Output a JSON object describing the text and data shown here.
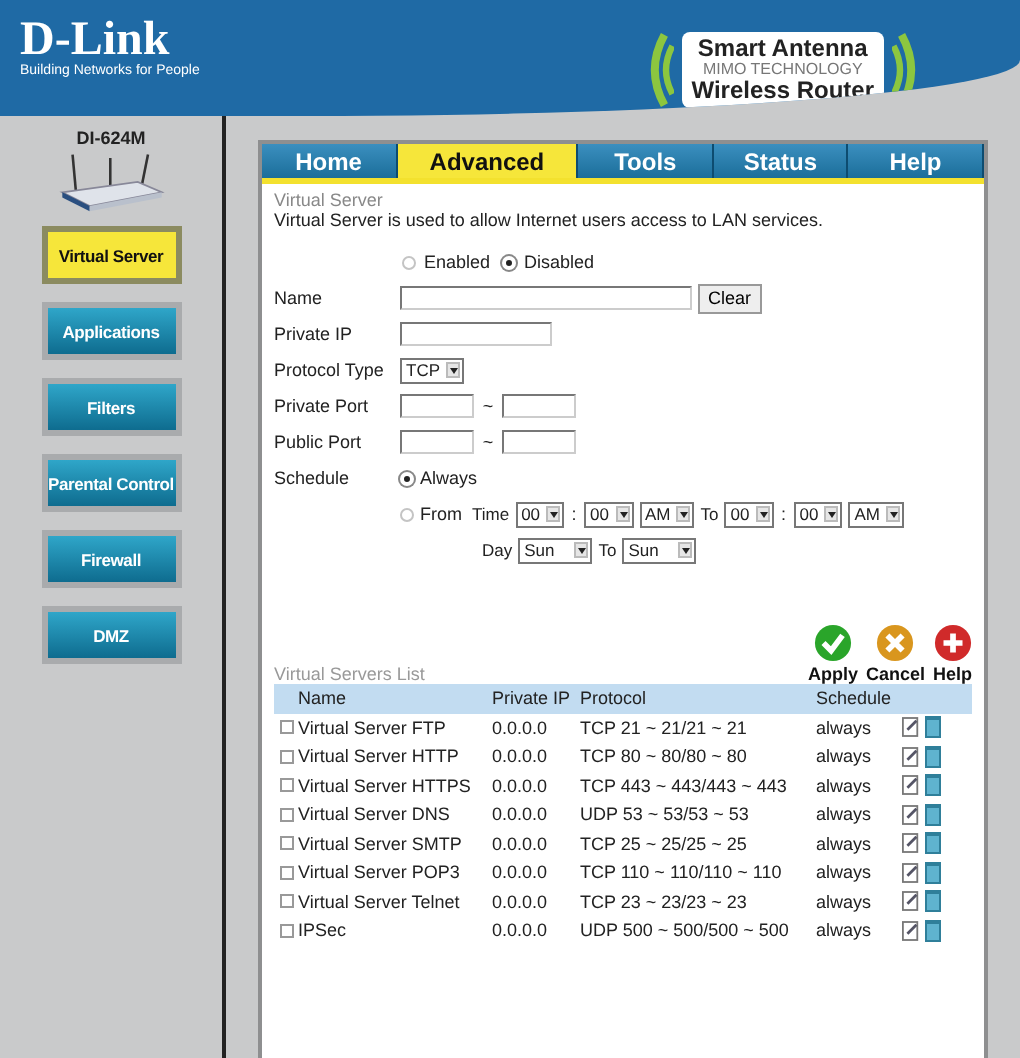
{
  "header": {
    "brand": "D-Link",
    "tagline": "Building Networks for People",
    "badge": [
      "Smart Antenna",
      "MIMO TECHNOLOGY",
      "Wireless Router"
    ]
  },
  "model": "DI-624M",
  "sidebar": {
    "items": [
      {
        "label": "Virtual Server",
        "selected": true
      },
      {
        "label": "Applications",
        "selected": false
      },
      {
        "label": "Filters",
        "selected": false
      },
      {
        "label": "Parental Control",
        "selected": false
      },
      {
        "label": "Firewall",
        "selected": false
      },
      {
        "label": "DMZ",
        "selected": false
      }
    ]
  },
  "tabs": [
    {
      "label": "Home",
      "selected": false
    },
    {
      "label": "Advanced",
      "selected": true
    },
    {
      "label": "Tools",
      "selected": false
    },
    {
      "label": "Status",
      "selected": false
    },
    {
      "label": "Help",
      "selected": false
    }
  ],
  "section": {
    "title": "Virtual Server",
    "description": "Virtual Server is used to allow Internet users access to LAN services."
  },
  "form": {
    "status": [
      {
        "label": "Enabled",
        "selected": false
      },
      {
        "label": "Disabled",
        "selected": true
      }
    ],
    "name_label": "Name",
    "clear_button": "Clear",
    "private_ip_label": "Private IP",
    "protocol_label": "Protocol Type",
    "protocol_value": "TCP",
    "private_port_label": "Private Port",
    "public_port_label": "Public Port",
    "port_separator": "~",
    "schedule_label": "Schedule",
    "schedule_options": [
      {
        "label": "Always",
        "selected": true
      },
      {
        "label": "From",
        "selected": false
      }
    ],
    "time_label": "Time",
    "time_from": [
      "00",
      "00",
      "AM"
    ],
    "time_to_label": "To",
    "time_to": [
      "00",
      "00",
      "AM"
    ],
    "colon": ":",
    "day_label": "Day",
    "day_from": "Sun",
    "day_to_label": "To",
    "day_to": "Sun"
  },
  "actions": [
    {
      "label": "Apply",
      "kind": "apply"
    },
    {
      "label": "Cancel",
      "kind": "cancel"
    },
    {
      "label": "Help",
      "kind": "help"
    }
  ],
  "list": {
    "title": "Virtual Servers List",
    "columns": [
      "Name",
      "Private IP",
      "Protocol",
      "Schedule"
    ],
    "rows": [
      {
        "checked": false,
        "name": "Virtual Server FTP",
        "ip": "0.0.0.0",
        "protocol": "TCP 21 ~ 21/21 ~ 21",
        "schedule": "always"
      },
      {
        "checked": false,
        "name": "Virtual Server HTTP",
        "ip": "0.0.0.0",
        "protocol": "TCP 80 ~ 80/80 ~ 80",
        "schedule": "always"
      },
      {
        "checked": false,
        "name": "Virtual Server HTTPS",
        "ip": "0.0.0.0",
        "protocol": "TCP 443 ~ 443/443 ~ 443",
        "schedule": "always"
      },
      {
        "checked": false,
        "name": "Virtual Server DNS",
        "ip": "0.0.0.0",
        "protocol": "UDP 53 ~ 53/53 ~ 53",
        "schedule": "always"
      },
      {
        "checked": false,
        "name": "Virtual Server SMTP",
        "ip": "0.0.0.0",
        "protocol": "TCP 25 ~ 25/25 ~ 25",
        "schedule": "always"
      },
      {
        "checked": false,
        "name": "Virtual Server POP3",
        "ip": "0.0.0.0",
        "protocol": "TCP 110 ~ 110/110 ~ 110",
        "schedule": "always"
      },
      {
        "checked": false,
        "name": "Virtual Server Telnet",
        "ip": "0.0.0.0",
        "protocol": "TCP 23 ~ 23/23 ~ 23",
        "schedule": "always"
      },
      {
        "checked": false,
        "name": "IPSec",
        "ip": "0.0.0.0",
        "protocol": "UDP 500 ~ 500/500 ~ 500",
        "schedule": "always"
      }
    ]
  }
}
